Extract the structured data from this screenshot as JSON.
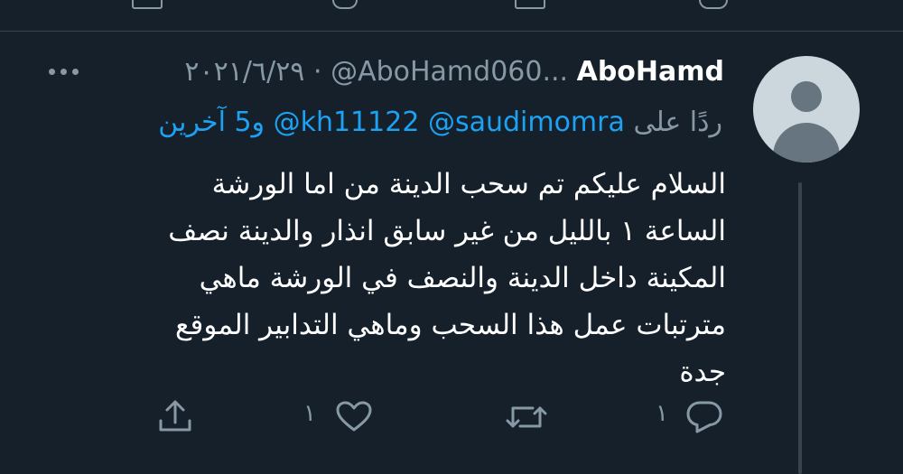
{
  "tweet": {
    "display_name": "AboHamd",
    "handle": "@AboHamd060...",
    "separator": "·",
    "date": "٢٠٢١/٦/٢٩",
    "reply_prefix": "ردًا على",
    "reply_handles": [
      "@saudimomra",
      "@kh11122"
    ],
    "reply_more": "و5 آخرين",
    "body_lines": [
      "السلام عليكم تم سحب الدينة من اما الورشة",
      "الساعة ١ بالليل من غير سابق انذار والدينة نصف",
      "المكينة داخل الدينة والنصف في الورشة ماهي",
      "مترتبات عمل هذا السحب وماهي التدابير  الموقع",
      "جدة"
    ]
  },
  "actions": {
    "reply_count": "١",
    "retweet_count": "",
    "like_count": "١"
  },
  "icons": {
    "more": "more-horizontal-icon",
    "reply": "reply-icon",
    "retweet": "retweet-icon",
    "like": "heart-icon",
    "share": "share-icon"
  },
  "colors": {
    "background": "#15202b",
    "primary_text": "#ffffff",
    "secondary_text": "#8899a6",
    "link": "#1da1f2",
    "divider": "#38444d",
    "avatar_bg": "#ccd6dd",
    "avatar_fg": "#66757f"
  }
}
